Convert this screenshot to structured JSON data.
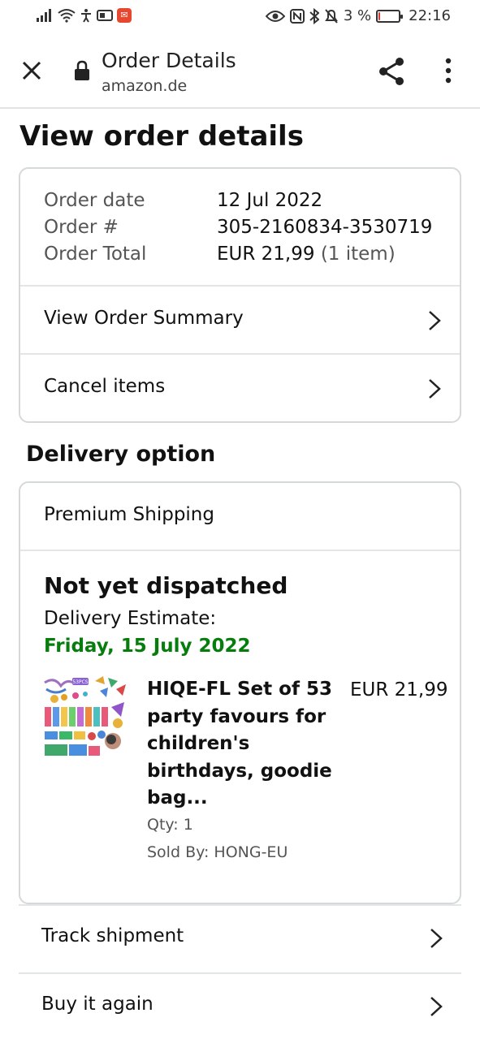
{
  "status_bar": {
    "battery_percent": "3 %",
    "time": "22:16",
    "battery_level": 0.03
  },
  "browser": {
    "title": "Order Details",
    "domain": "amazon.de"
  },
  "page": {
    "title": "View order details"
  },
  "order": {
    "date_label": "Order date",
    "date_value": "12 Jul 2022",
    "number_label": "Order #",
    "number_value": "305-2160834-3530719",
    "total_label": "Order Total",
    "total_value": "EUR 21,99",
    "total_items": "(1 item)",
    "summary_link": "View Order Summary",
    "cancel_link": "Cancel items"
  },
  "delivery": {
    "section_title": "Delivery option",
    "shipping_method": "Premium Shipping",
    "status": "Not yet dispatched",
    "estimate_label": "Delivery Estimate:",
    "estimate_date": "Friday, 15 July 2022",
    "product": {
      "title": "HIQE-FL Set of 53 party favours for children's birthdays, goodie bag...",
      "price": "EUR 21,99",
      "qty": "Qty: 1",
      "seller": "Sold By: HONG-EU",
      "thumb_badge": "53PCS"
    }
  },
  "actions": {
    "track": "Track shipment",
    "buy_again": "Buy it again"
  },
  "colors": {
    "accent_green": "#067d0c",
    "border": "#d5d9d9"
  }
}
